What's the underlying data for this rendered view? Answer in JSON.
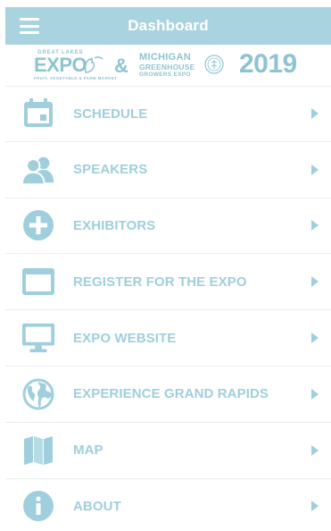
{
  "header": {
    "title": "Dashboard",
    "menu_icon": "hamburger-icon"
  },
  "banner": {
    "logo_left_top": "GREAT LAKES",
    "logo_left_main": "EXPO",
    "logo_left_sub": "FRUIT, VEGETABLE & FARM MARKET",
    "ampersand": "&",
    "logo_right_line1": "MICHIGAN",
    "logo_right_line2": "GREENHOUSE",
    "logo_right_line3": "GROWERS EXPO",
    "year": "2019"
  },
  "menu": {
    "items": [
      {
        "label": "SCHEDULE",
        "icon": "calendar-icon"
      },
      {
        "label": "SPEAKERS",
        "icon": "users-icon"
      },
      {
        "label": "EXHIBITORS",
        "icon": "plus-circle-icon"
      },
      {
        "label": "REGISTER FOR THE EXPO",
        "icon": "browser-window-icon"
      },
      {
        "label": "EXPO WEBSITE",
        "icon": "monitor-icon"
      },
      {
        "label": "EXPERIENCE GRAND RAPIDS",
        "icon": "globe-icon"
      },
      {
        "label": "MAP",
        "icon": "map-icon"
      },
      {
        "label": "ABOUT",
        "icon": "info-icon"
      }
    ]
  },
  "colors": {
    "accent": "#a9d3de",
    "icon": "#9fcfdc",
    "text": "#9fcfdc",
    "logo": "#8ec3d2"
  }
}
